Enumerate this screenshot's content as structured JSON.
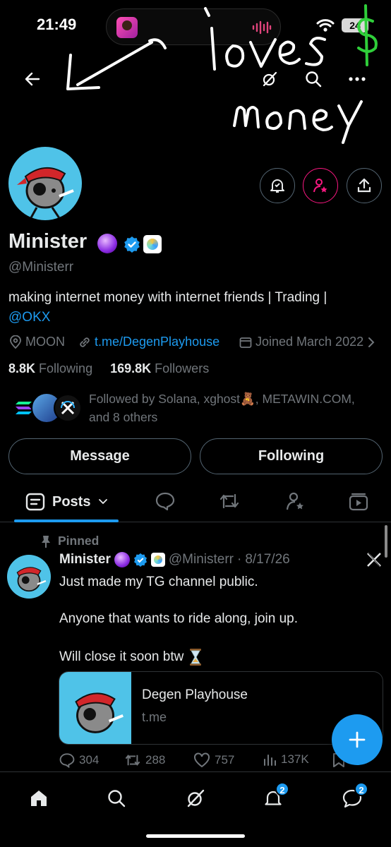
{
  "status_bar": {
    "time": "21:49",
    "battery": "24"
  },
  "banner": {
    "scribble_text_1": "loves",
    "scribble_text_2": "money",
    "scribble_symbol": "$"
  },
  "header": {
    "back_icon": "arrow-left-icon",
    "grok_icon": "grok-icon",
    "search_icon": "search-icon",
    "more_icon": "more-icon"
  },
  "profile": {
    "name": "Minister",
    "handle": "@Ministerr",
    "bio_text": "making internet money with internet friends | Trading |",
    "bio_mention": "@OKX",
    "location": "MOON",
    "link": "t.me/DegenPlayhouse",
    "joined": "Joined March 2022",
    "following_count": "8.8K",
    "following_label": "Following",
    "followers_count": "169.8K",
    "followers_label": "Followers",
    "followed_by": "Followed by Solana, xghost🧸, METAWIN.COM, and 8 others"
  },
  "buttons": {
    "message": "Message",
    "following": "Following"
  },
  "tabs": {
    "posts": "Posts"
  },
  "post": {
    "pinned_label": "Pinned",
    "author": "Minister",
    "handle": "@Ministerr",
    "separator": "·",
    "date": "8/17/26",
    "line1": "Just made my TG channel public.",
    "line2": "Anyone that wants to ride along, join up.",
    "line3": "Will close it soon btw",
    "card_title": "Degen Playhouse",
    "card_domain": "t.me",
    "replies": "304",
    "reposts": "288",
    "likes": "757",
    "views": "137K"
  },
  "nav": {
    "notifications_badge": "2",
    "messages_badge": "2"
  },
  "colors": {
    "accent": "#1d9bf0",
    "pink": "#f91880",
    "muted": "#71767b",
    "text": "#e7e9ea",
    "background": "#000000"
  }
}
